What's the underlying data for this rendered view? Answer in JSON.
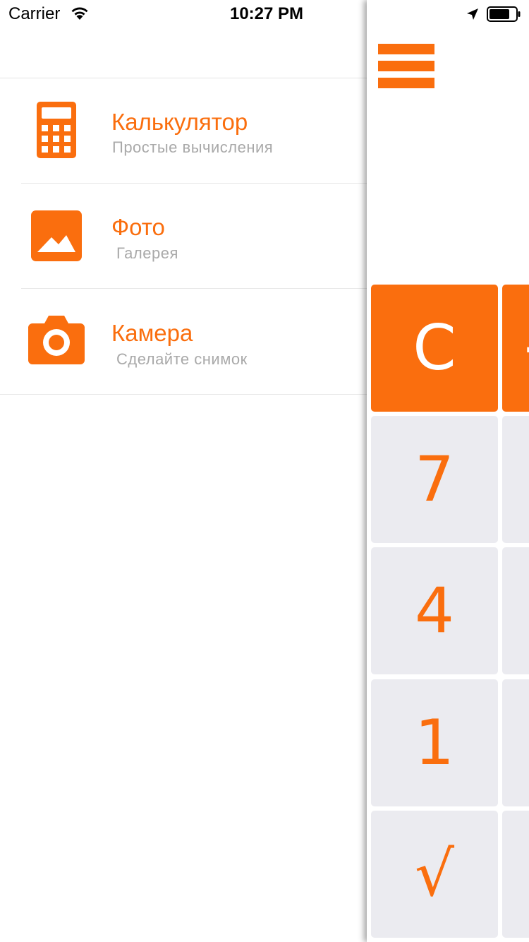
{
  "status_bar": {
    "carrier": "Carrier",
    "time": "10:27 PM",
    "icons": [
      "wifi-icon",
      "location-arrow-icon",
      "battery-icon"
    ]
  },
  "menu": {
    "items": [
      {
        "title": "Калькулятор",
        "subtitle": "Простые вычисления",
        "icon": "calculator-icon"
      },
      {
        "title": "Фото",
        "subtitle": "Галерея",
        "icon": "photo-icon"
      },
      {
        "title": "Камера",
        "subtitle": "Сделайте снимок",
        "icon": "camera-icon"
      }
    ]
  },
  "calculator": {
    "menu_button_icon": "hamburger-icon",
    "display_value": "",
    "keys": [
      {
        "label": "C",
        "style": "orange"
      },
      {
        "label": "+/-",
        "style": "orange"
      },
      {
        "label": "7",
        "style": "gray"
      },
      {
        "label": "",
        "style": "gray"
      },
      {
        "label": "4",
        "style": "gray"
      },
      {
        "label": "",
        "style": "gray"
      },
      {
        "label": "1",
        "style": "gray"
      },
      {
        "label": "",
        "style": "gray"
      },
      {
        "label": "√",
        "style": "gray"
      },
      {
        "label": "",
        "style": "gray"
      }
    ]
  },
  "colors": {
    "accent": "#fa6e0e",
    "key_gray": "#ebebf0",
    "subtitle_gray": "#a9a9a9",
    "divider": "#e8e8e8"
  }
}
